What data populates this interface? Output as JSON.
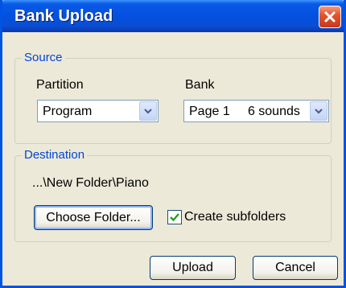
{
  "window": {
    "title": "Bank Upload"
  },
  "source": {
    "legend": "Source",
    "partition_label": "Partition",
    "partition_value": "Program",
    "bank_label": "Bank",
    "bank_value": "Page 1     6 sounds"
  },
  "destination": {
    "legend": "Destination",
    "path": "...\\New Folder\\Piano",
    "choose_folder_label": "Choose Folder...",
    "create_subfolders_label": "Create subfolders",
    "create_subfolders_checked": true
  },
  "footer": {
    "upload_label": "Upload",
    "cancel_label": "Cancel"
  },
  "icons": [
    "close-icon",
    "chevron-down-icon",
    "checkmark-icon"
  ]
}
